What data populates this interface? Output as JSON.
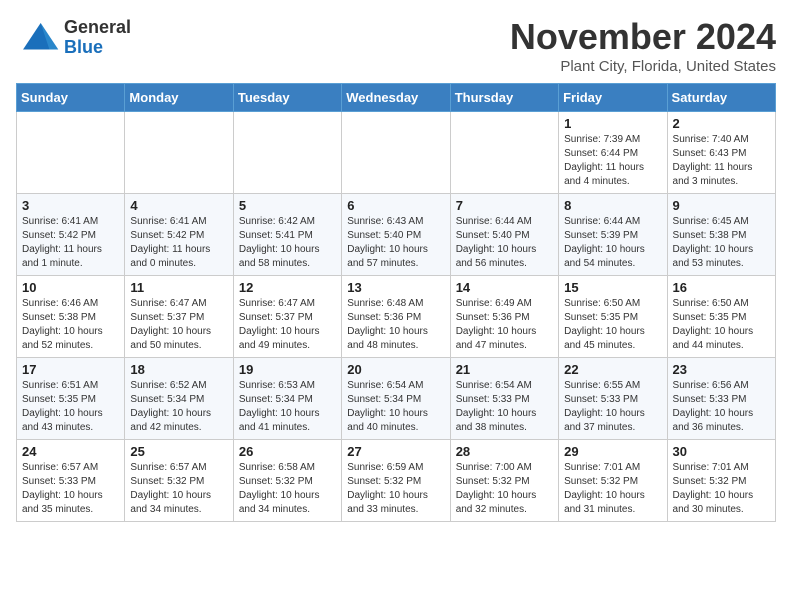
{
  "header": {
    "title": "November 2024",
    "subtitle": "Plant City, Florida, United States",
    "logo_general": "General",
    "logo_blue": "Blue"
  },
  "days_of_week": [
    "Sunday",
    "Monday",
    "Tuesday",
    "Wednesday",
    "Thursday",
    "Friday",
    "Saturday"
  ],
  "weeks": [
    [
      {
        "day": "",
        "info": ""
      },
      {
        "day": "",
        "info": ""
      },
      {
        "day": "",
        "info": ""
      },
      {
        "day": "",
        "info": ""
      },
      {
        "day": "",
        "info": ""
      },
      {
        "day": "1",
        "info": "Sunrise: 7:39 AM\nSunset: 6:44 PM\nDaylight: 11 hours and 4 minutes."
      },
      {
        "day": "2",
        "info": "Sunrise: 7:40 AM\nSunset: 6:43 PM\nDaylight: 11 hours and 3 minutes."
      }
    ],
    [
      {
        "day": "3",
        "info": "Sunrise: 6:41 AM\nSunset: 5:42 PM\nDaylight: 11 hours and 1 minute."
      },
      {
        "day": "4",
        "info": "Sunrise: 6:41 AM\nSunset: 5:42 PM\nDaylight: 11 hours and 0 minutes."
      },
      {
        "day": "5",
        "info": "Sunrise: 6:42 AM\nSunset: 5:41 PM\nDaylight: 10 hours and 58 minutes."
      },
      {
        "day": "6",
        "info": "Sunrise: 6:43 AM\nSunset: 5:40 PM\nDaylight: 10 hours and 57 minutes."
      },
      {
        "day": "7",
        "info": "Sunrise: 6:44 AM\nSunset: 5:40 PM\nDaylight: 10 hours and 56 minutes."
      },
      {
        "day": "8",
        "info": "Sunrise: 6:44 AM\nSunset: 5:39 PM\nDaylight: 10 hours and 54 minutes."
      },
      {
        "day": "9",
        "info": "Sunrise: 6:45 AM\nSunset: 5:38 PM\nDaylight: 10 hours and 53 minutes."
      }
    ],
    [
      {
        "day": "10",
        "info": "Sunrise: 6:46 AM\nSunset: 5:38 PM\nDaylight: 10 hours and 52 minutes."
      },
      {
        "day": "11",
        "info": "Sunrise: 6:47 AM\nSunset: 5:37 PM\nDaylight: 10 hours and 50 minutes."
      },
      {
        "day": "12",
        "info": "Sunrise: 6:47 AM\nSunset: 5:37 PM\nDaylight: 10 hours and 49 minutes."
      },
      {
        "day": "13",
        "info": "Sunrise: 6:48 AM\nSunset: 5:36 PM\nDaylight: 10 hours and 48 minutes."
      },
      {
        "day": "14",
        "info": "Sunrise: 6:49 AM\nSunset: 5:36 PM\nDaylight: 10 hours and 47 minutes."
      },
      {
        "day": "15",
        "info": "Sunrise: 6:50 AM\nSunset: 5:35 PM\nDaylight: 10 hours and 45 minutes."
      },
      {
        "day": "16",
        "info": "Sunrise: 6:50 AM\nSunset: 5:35 PM\nDaylight: 10 hours and 44 minutes."
      }
    ],
    [
      {
        "day": "17",
        "info": "Sunrise: 6:51 AM\nSunset: 5:35 PM\nDaylight: 10 hours and 43 minutes."
      },
      {
        "day": "18",
        "info": "Sunrise: 6:52 AM\nSunset: 5:34 PM\nDaylight: 10 hours and 42 minutes."
      },
      {
        "day": "19",
        "info": "Sunrise: 6:53 AM\nSunset: 5:34 PM\nDaylight: 10 hours and 41 minutes."
      },
      {
        "day": "20",
        "info": "Sunrise: 6:54 AM\nSunset: 5:34 PM\nDaylight: 10 hours and 40 minutes."
      },
      {
        "day": "21",
        "info": "Sunrise: 6:54 AM\nSunset: 5:33 PM\nDaylight: 10 hours and 38 minutes."
      },
      {
        "day": "22",
        "info": "Sunrise: 6:55 AM\nSunset: 5:33 PM\nDaylight: 10 hours and 37 minutes."
      },
      {
        "day": "23",
        "info": "Sunrise: 6:56 AM\nSunset: 5:33 PM\nDaylight: 10 hours and 36 minutes."
      }
    ],
    [
      {
        "day": "24",
        "info": "Sunrise: 6:57 AM\nSunset: 5:33 PM\nDaylight: 10 hours and 35 minutes."
      },
      {
        "day": "25",
        "info": "Sunrise: 6:57 AM\nSunset: 5:32 PM\nDaylight: 10 hours and 34 minutes."
      },
      {
        "day": "26",
        "info": "Sunrise: 6:58 AM\nSunset: 5:32 PM\nDaylight: 10 hours and 34 minutes."
      },
      {
        "day": "27",
        "info": "Sunrise: 6:59 AM\nSunset: 5:32 PM\nDaylight: 10 hours and 33 minutes."
      },
      {
        "day": "28",
        "info": "Sunrise: 7:00 AM\nSunset: 5:32 PM\nDaylight: 10 hours and 32 minutes."
      },
      {
        "day": "29",
        "info": "Sunrise: 7:01 AM\nSunset: 5:32 PM\nDaylight: 10 hours and 31 minutes."
      },
      {
        "day": "30",
        "info": "Sunrise: 7:01 AM\nSunset: 5:32 PM\nDaylight: 10 hours and 30 minutes."
      }
    ]
  ]
}
